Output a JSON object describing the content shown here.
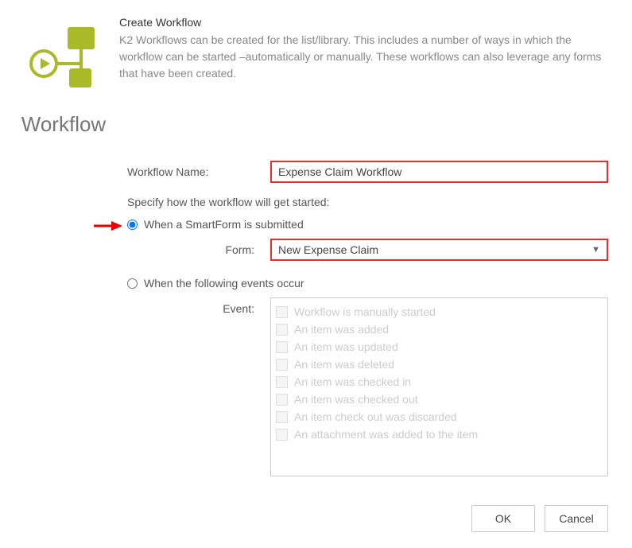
{
  "icon_title": "Workflow",
  "header": "Create Workflow",
  "description": "K2 Workflows can be created for the list/library.  This includes a number of ways in which the workflow can be started –automatically or manually.  These workflows can also leverage any forms that have been created.",
  "name_label": "Workflow Name:",
  "name_value": "Expense Claim Workflow",
  "specify_text": "Specify how the workflow will get started:",
  "radio1_label": "When a SmartForm is submitted",
  "radio2_label": "When the following events occur",
  "form_label": "Form:",
  "form_value": "New Expense Claim",
  "event_label": "Event:",
  "events": [
    "Workflow is manually started",
    "An item was added",
    "An item was updated",
    "An item was deleted",
    "An item was checked in",
    "An item was checked out",
    "An item check out was discarded",
    "An attachment was added to the item"
  ],
  "ok_label": "OK",
  "cancel_label": "Cancel"
}
